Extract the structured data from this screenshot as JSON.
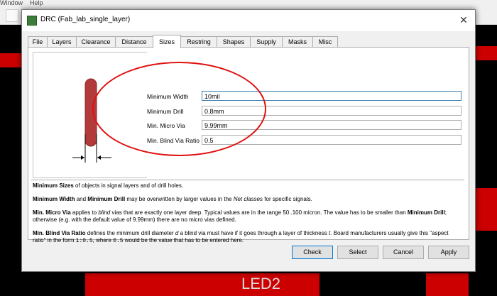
{
  "app": {
    "menu": [
      "Window",
      "Help"
    ],
    "pcb_label": "LED2"
  },
  "dialog": {
    "title": "DRC (Fab_lab_single_layer)",
    "close_symbol": "✕",
    "tabs": [
      {
        "label": "File"
      },
      {
        "label": "Layers"
      },
      {
        "label": "Clearance"
      },
      {
        "label": "Distance"
      },
      {
        "label": "Sizes",
        "active": true
      },
      {
        "label": "Restring"
      },
      {
        "label": "Shapes"
      },
      {
        "label": "Supply"
      },
      {
        "label": "Masks"
      },
      {
        "label": "Misc"
      }
    ],
    "fields": [
      {
        "label": "Minimum Width",
        "value": "10mil"
      },
      {
        "label": "Minimum Drill",
        "value": "0.8mm"
      },
      {
        "label": "Min. Micro Via",
        "value": "9.99mm"
      },
      {
        "label": "Min. Blind Via Ratio",
        "value": "0.5"
      }
    ],
    "help": {
      "p1_b": "Minimum Sizes",
      "p1_t": " of objects in signal layers and of drill holes.",
      "p2_b1": "Minimum Width",
      "p2_t1": " and ",
      "p2_b2": "Minimum Drill",
      "p2_t2": " may be overwritten by larger values in the ",
      "p2_i": "Net classes",
      "p2_t3": " for specific signals.",
      "p3_b1": "Min. Micro Via",
      "p3_t1": " applies to ",
      "p3_i": "blind",
      "p3_t2": " vias that are exactly one layer deep. Typical values are in the range 50..100 micron. The value has to be smaller than ",
      "p3_b2": "Minimum Drill",
      "p3_t3": "; otherwise (e.g. with the default value of 9.99mm) there are no micro vias defined.",
      "p4_b": "Min. Blind Via Ratio",
      "p4_t1": " defines the minimum drill diameter ",
      "p4_i1": "d",
      "p4_t2": " a blind via must have if it goes through a layer of thickness ",
      "p4_i2": "t",
      "p4_t3": ". Board manufacturers usually give this \"aspect ratio\" in the form ",
      "p4_m1": "1:0.5",
      "p4_t4": ", where ",
      "p4_m2": "0.5",
      "p4_t5": " would be the value that has to be entered here."
    },
    "buttons": {
      "check": "Check",
      "select": "Select",
      "cancel": "Cancel",
      "apply": "Apply"
    }
  },
  "colors": {
    "annotation": "#e01010",
    "trace": "#b33a3a",
    "accent": "#0078d7"
  }
}
